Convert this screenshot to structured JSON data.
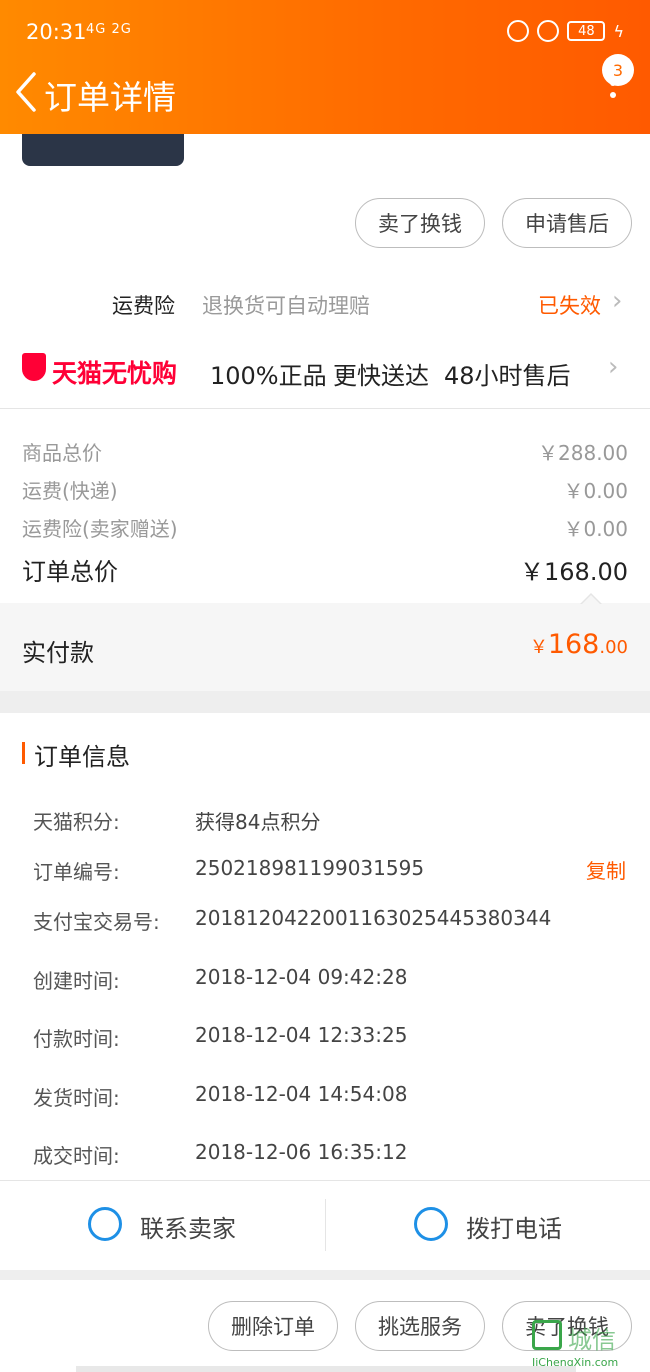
{
  "status_bar": {
    "time": "20:31",
    "signal": "4G 2G",
    "battery": "48"
  },
  "header": {
    "title": "订单详情",
    "badge_count": "3"
  },
  "actions_top": {
    "sell_label": "卖了换钱",
    "aftersale_label": "申请售后"
  },
  "insurance": {
    "label": "运费险",
    "desc": "退换货可自动理赔",
    "status": "已失效"
  },
  "tmall": {
    "brand": "天猫无忧购",
    "features": [
      "100%正品",
      "更快送达",
      "48小时售后"
    ]
  },
  "price": {
    "rows": [
      {
        "label": "商品总价",
        "value": "￥288.00"
      },
      {
        "label": "运费(快递)",
        "value": "￥0.00"
      },
      {
        "label": "运费险(卖家赠送)",
        "value": "￥0.00"
      }
    ],
    "total_label": "订单总价",
    "total_value": "￥168.00",
    "paid_label": "实付款",
    "paid_currency": "￥",
    "paid_int": "168",
    "paid_dec": ".00"
  },
  "order_info": {
    "title": "订单信息",
    "rows": [
      {
        "label": "天猫积分:",
        "value": "获得84点积分"
      },
      {
        "label": "订单编号:",
        "value": "250218981199031595"
      },
      {
        "label": "支付宝交易号:",
        "value": "2018120422001163025445380344"
      },
      {
        "label": "创建时间:",
        "value": "2018-12-04 09:42:28"
      },
      {
        "label": "付款时间:",
        "value": "2018-12-04 12:33:25"
      },
      {
        "label": "发货时间:",
        "value": "2018-12-04 14:54:08"
      },
      {
        "label": "成交时间:",
        "value": "2018-12-06 16:35:12"
      }
    ],
    "copy_label": "复制"
  },
  "contact": {
    "seller_label": "联系卖家",
    "phone_label": "拨打电话"
  },
  "actions_bottom": {
    "delete_label": "删除订单",
    "service_label": "挑选服务",
    "sell_label": "卖了换钱"
  },
  "watermark": {
    "text": "城信",
    "sub": "JiChengXin.com"
  },
  "colors": {
    "accent": "#ff5a00",
    "tmall_red": "#ff0036",
    "link_blue": "#1e90e6"
  }
}
